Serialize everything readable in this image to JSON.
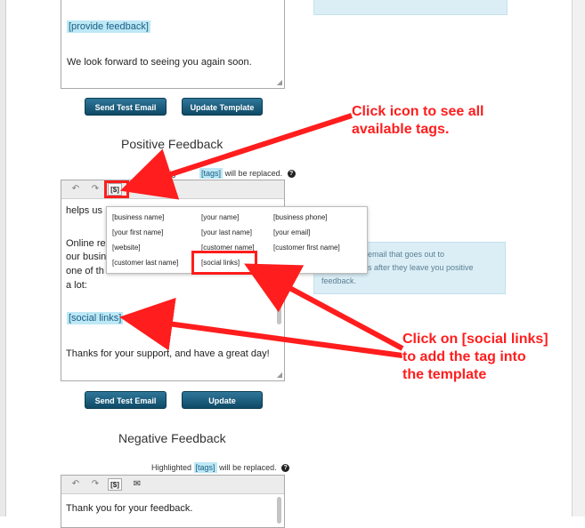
{
  "templates": {
    "top_tag": "[provide feedback]",
    "top_closing": "We look forward to seeing you again soon.",
    "send_test_label": "Send Test Email",
    "update_template_label": "Update Template",
    "update_label": "Update"
  },
  "highlight_note": {
    "prefix": "Highlighted",
    "tag_word": "[tags]",
    "suffix": "will be replaced.",
    "help_glyph": "?"
  },
  "positive": {
    "title": "Positive Feedback",
    "note_prefix": "Highlig",
    "note_tag_word": "[tags]",
    "note_suffix": "will be replaced.",
    "toolbar": {
      "undo_icon": "↶",
      "redo_icon": "↷",
      "tags_button": "[$]",
      "email_icon": "✉"
    },
    "lines": [
      "helps us",
      "Online re",
      "our busin",
      "one of th",
      "a lot:"
    ],
    "tag": "[social links]",
    "closing": "Thanks for your support, and have a great day!"
  },
  "tag_dropdown": {
    "items": [
      "[business name]",
      "[your name]",
      "[business phone]",
      "[your first name]",
      "[your last name]",
      "[your email]",
      "[website]",
      "[customer name]",
      "[customer first name]",
      "[customer last name]",
      "[social links]"
    ]
  },
  "info_box": {
    "line1": "email that goes out to",
    "line2": "s after they leave you positive",
    "line3": "feedback."
  },
  "negative": {
    "title": "Negative Feedback",
    "first_line": "Thank you for your feedback."
  },
  "callouts": {
    "tags_help": [
      "Click icon to see all",
      "available tags."
    ],
    "social_help": [
      "Click on [social links]",
      "to add the tag into",
      "the template"
    ]
  }
}
